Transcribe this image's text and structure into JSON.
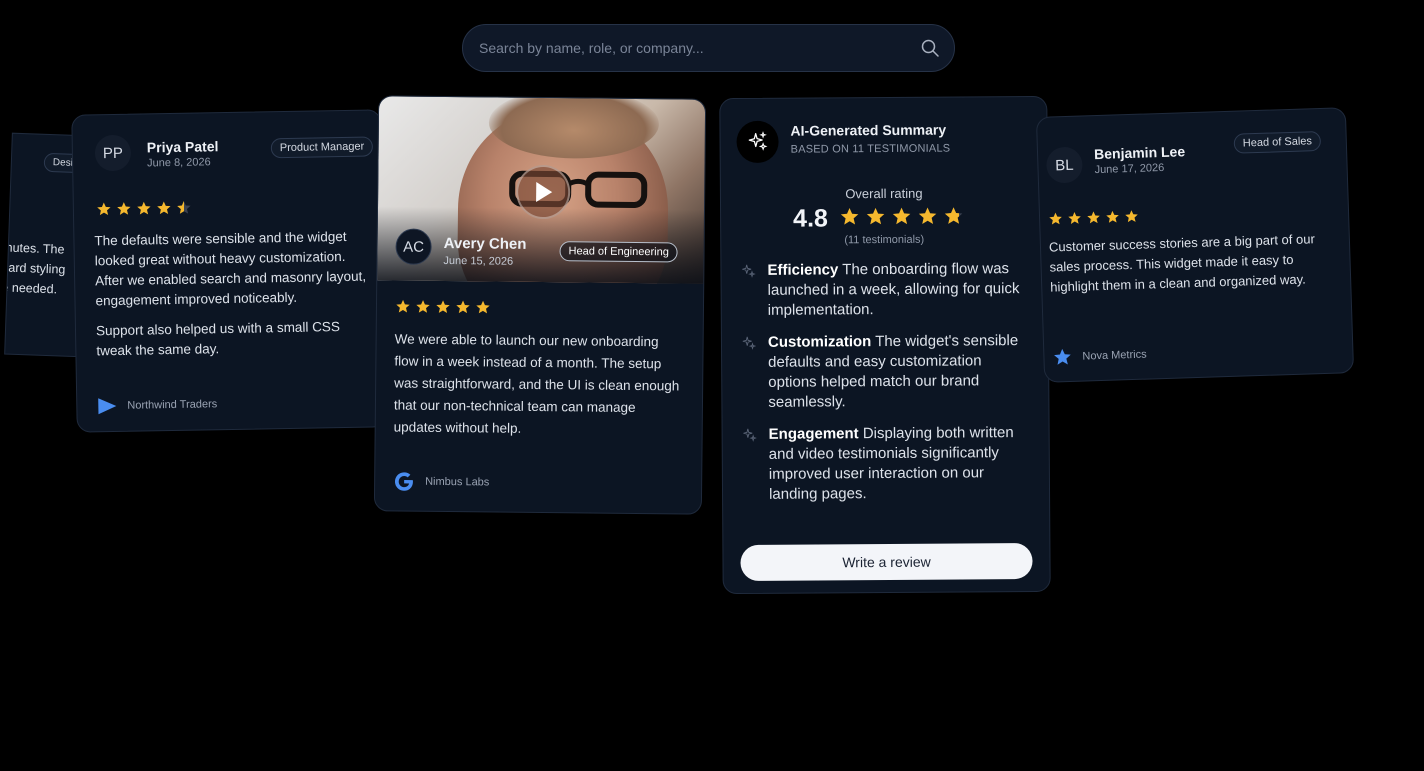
{
  "search": {
    "placeholder": "Search by name, role, or company..."
  },
  "colors": {
    "star": "#f5b82e",
    "background": "#000000",
    "card": "#0c1523"
  },
  "cards": {
    "partial": {
      "role": "Desig",
      "lines": [
        "inutes. The",
        "card styling",
        "e needed."
      ]
    },
    "priya": {
      "initials": "PP",
      "name": "Priya Patel",
      "date": "June 8, 2026",
      "role": "Product Manager",
      "rating": 4.5,
      "paragraph1": "The defaults were sensible and the widget looked great without heavy customization. After we enabled search and masonry layout, engagement improved noticeably.",
      "paragraph2": "Support also helped us with a small CSS tweak the same day.",
      "company": "Northwind Traders",
      "company_icon": "play-triangle-logo"
    },
    "avery": {
      "initials": "AC",
      "name": "Avery Chen",
      "date": "June 15, 2026",
      "role": "Head of Engineering",
      "rating": 5,
      "text": "We were able to launch our new onboarding flow in a week instead of a month. The setup was straightforward, and the UI is clean enough that our non-technical team can manage updates without help.",
      "company": "Nimbus Labs",
      "company_icon": "google-g-logo"
    },
    "summary": {
      "title": "AI-Generated Summary",
      "subtitle": "BASED ON 11 TESTIMONIALS",
      "overall_label": "Overall rating",
      "score": "4.8",
      "rating": 4.8,
      "count": "(11 testimonials)",
      "insights": [
        {
          "title": "Efficiency",
          "text": "The onboarding flow was launched in a week, allowing for quick implementation."
        },
        {
          "title": "Customization",
          "text": "The widget's sensible defaults and easy customization options helped match our brand seamlessly."
        },
        {
          "title": "Engagement",
          "text": "Displaying both written and video testimonials significantly improved user interaction on our landing pages."
        }
      ],
      "button": "Write a review"
    },
    "benjamin": {
      "initials": "BL",
      "name": "Benjamin Lee",
      "date": "June 17, 2026",
      "role": "Head of Sales",
      "rating": 5,
      "text": "Customer success stories are a big part of our sales process. This widget made it easy to highlight them in a clean and organized way.",
      "company": "Nova Metrics",
      "company_icon": "star-logo"
    }
  }
}
